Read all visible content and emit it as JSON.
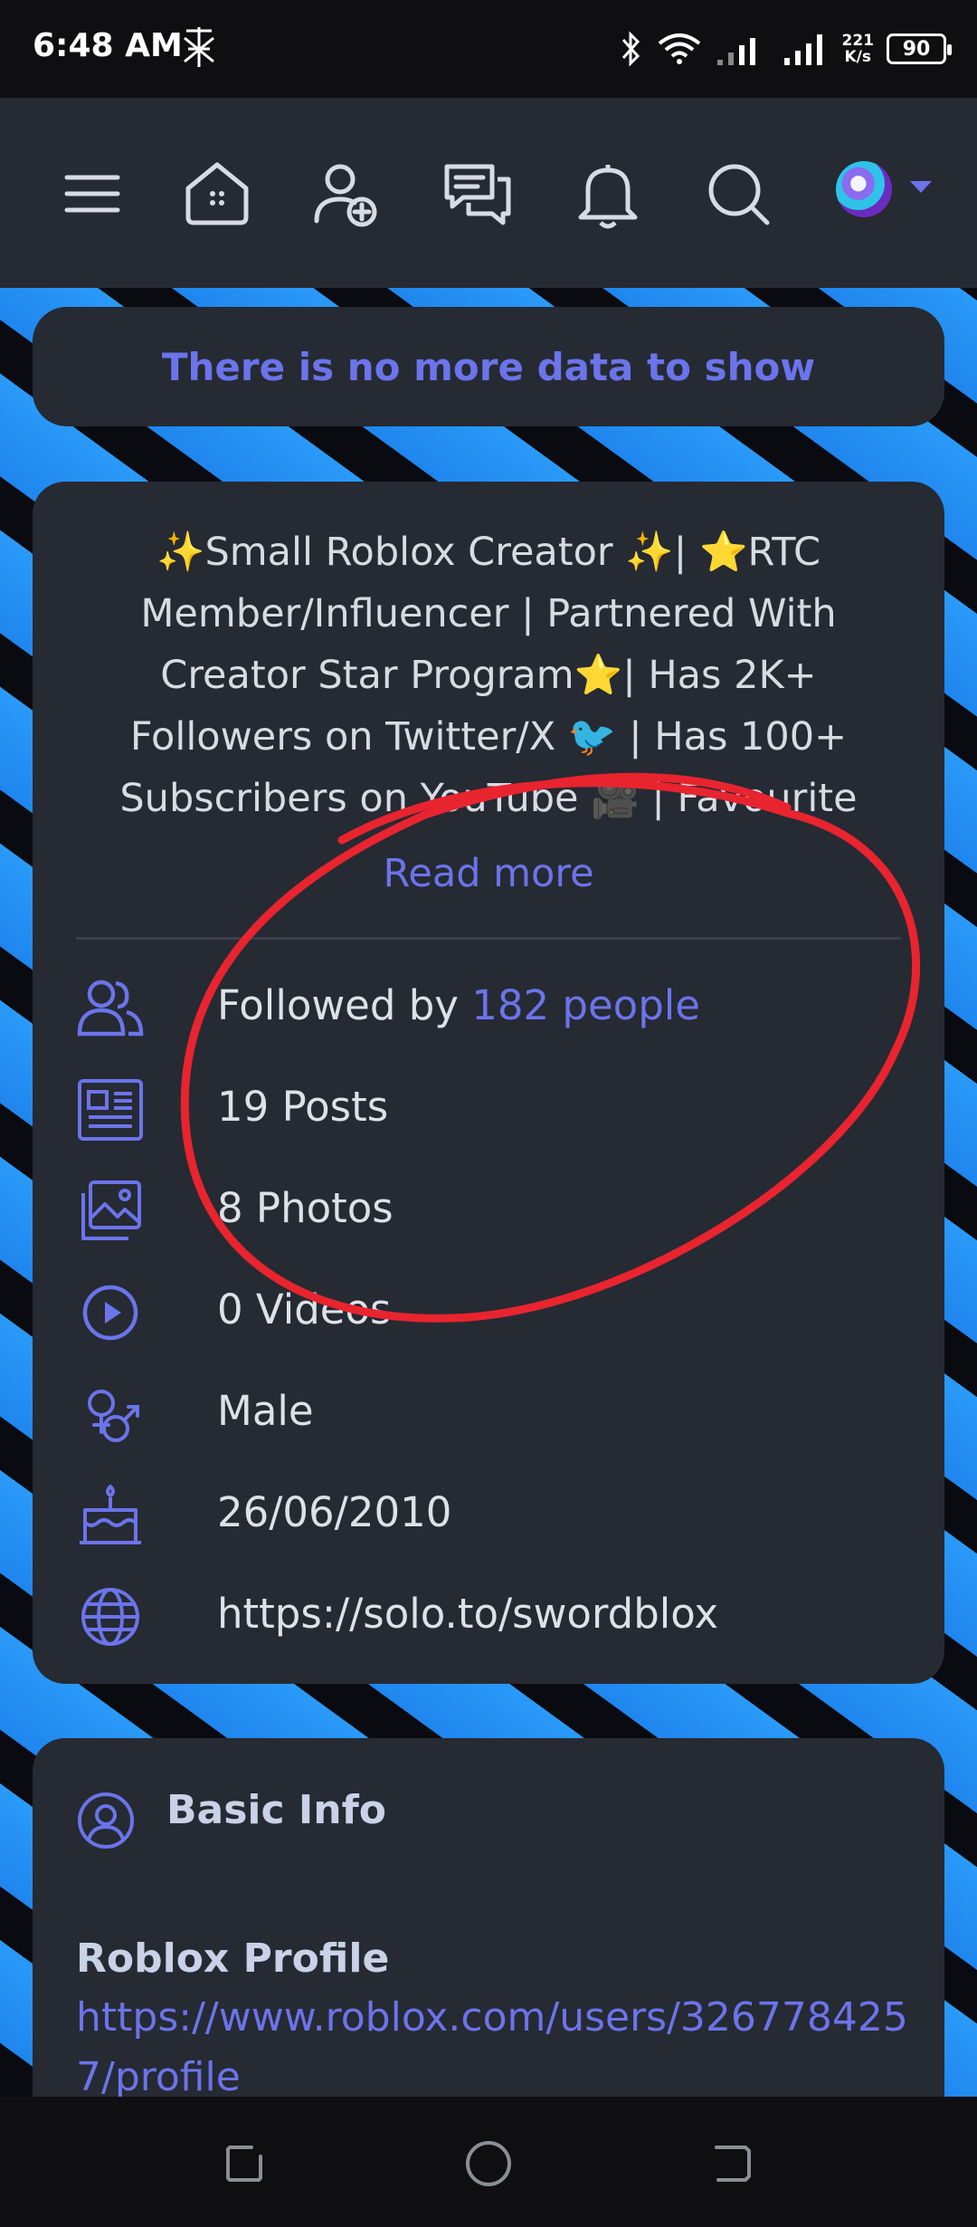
{
  "status_bar": {
    "time": "6:48 AM",
    "net_speed_value": "221",
    "net_speed_unit": "K/s",
    "battery": "90"
  },
  "nav": {
    "icons": [
      "menu-icon",
      "home-icon",
      "add-friend-icon",
      "messages-icon",
      "notifications-icon",
      "search-icon"
    ]
  },
  "notice": "There is no more data to show",
  "about": {
    "bio": "✨Small Roblox Creator ✨| ⭐RTC Member/Influencer | Partnered With Creator Star Program⭐| Has 2K+ Followers on Twitter/X 🐦 | Has 100+ Subscribers on YouTube 🎥 | Favourite",
    "read_more": "Read more",
    "followed_by_prefix": "Followed by ",
    "followed_by_count": "182 people",
    "posts": "19 Posts",
    "photos": "8 Photos",
    "videos": "0 Videos",
    "gender": "Male",
    "birthday": "26/06/2010",
    "website": "https://solo.to/swordblox"
  },
  "basic_info": {
    "title": "Basic Info",
    "roblox_label": "Roblox Profile",
    "roblox_url": "https://www.roblox.com/users/3267784257/profile"
  },
  "colors": {
    "accent": "#6b74ea",
    "card": "#262a33",
    "annotation": "#e8242f"
  }
}
